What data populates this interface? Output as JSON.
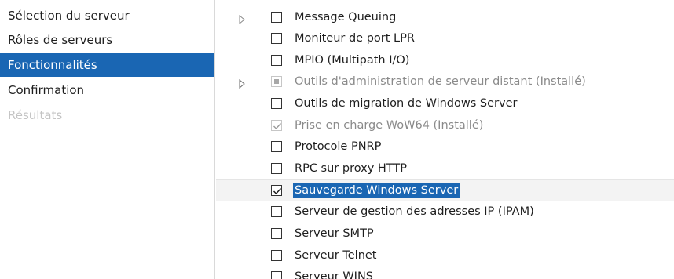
{
  "nav": {
    "items": [
      {
        "label": "Sélection du serveur"
      },
      {
        "label": "Rôles de serveurs"
      },
      {
        "label": "Fonctionnalités"
      },
      {
        "label": "Confirmation"
      },
      {
        "label": "Résultats"
      }
    ]
  },
  "features": {
    "items": [
      {
        "label": "Message Queuing",
        "checked": false,
        "has_children": true
      },
      {
        "label": "Moniteur de port LPR",
        "checked": false
      },
      {
        "label": "MPIO (Multipath I/O)",
        "checked": false
      },
      {
        "label": "Outils d'administration de serveur distant (Installé)",
        "checked": "partial",
        "disabled": true,
        "has_children": true
      },
      {
        "label": "Outils de migration de Windows Server",
        "checked": false
      },
      {
        "label": "Prise en charge WoW64 (Installé)",
        "checked": true,
        "disabled": true
      },
      {
        "label": "Protocole PNRP",
        "checked": false
      },
      {
        "label": "RPC sur proxy HTTP",
        "checked": false
      },
      {
        "label": "Sauvegarde Windows Server",
        "checked": true,
        "selected": true
      },
      {
        "label": "Serveur de gestion des adresses IP (IPAM)",
        "checked": false
      },
      {
        "label": "Serveur SMTP",
        "checked": false
      },
      {
        "label": "Serveur Telnet",
        "checked": false
      },
      {
        "label": "Serveur WINS",
        "checked": false
      }
    ]
  },
  "colors": {
    "selection": "#1a66b3",
    "disabled_text": "#8a8a8a"
  },
  "icons": {
    "expander": "triangle-right-icon",
    "checkbox_checked": "checkmark-icon"
  }
}
